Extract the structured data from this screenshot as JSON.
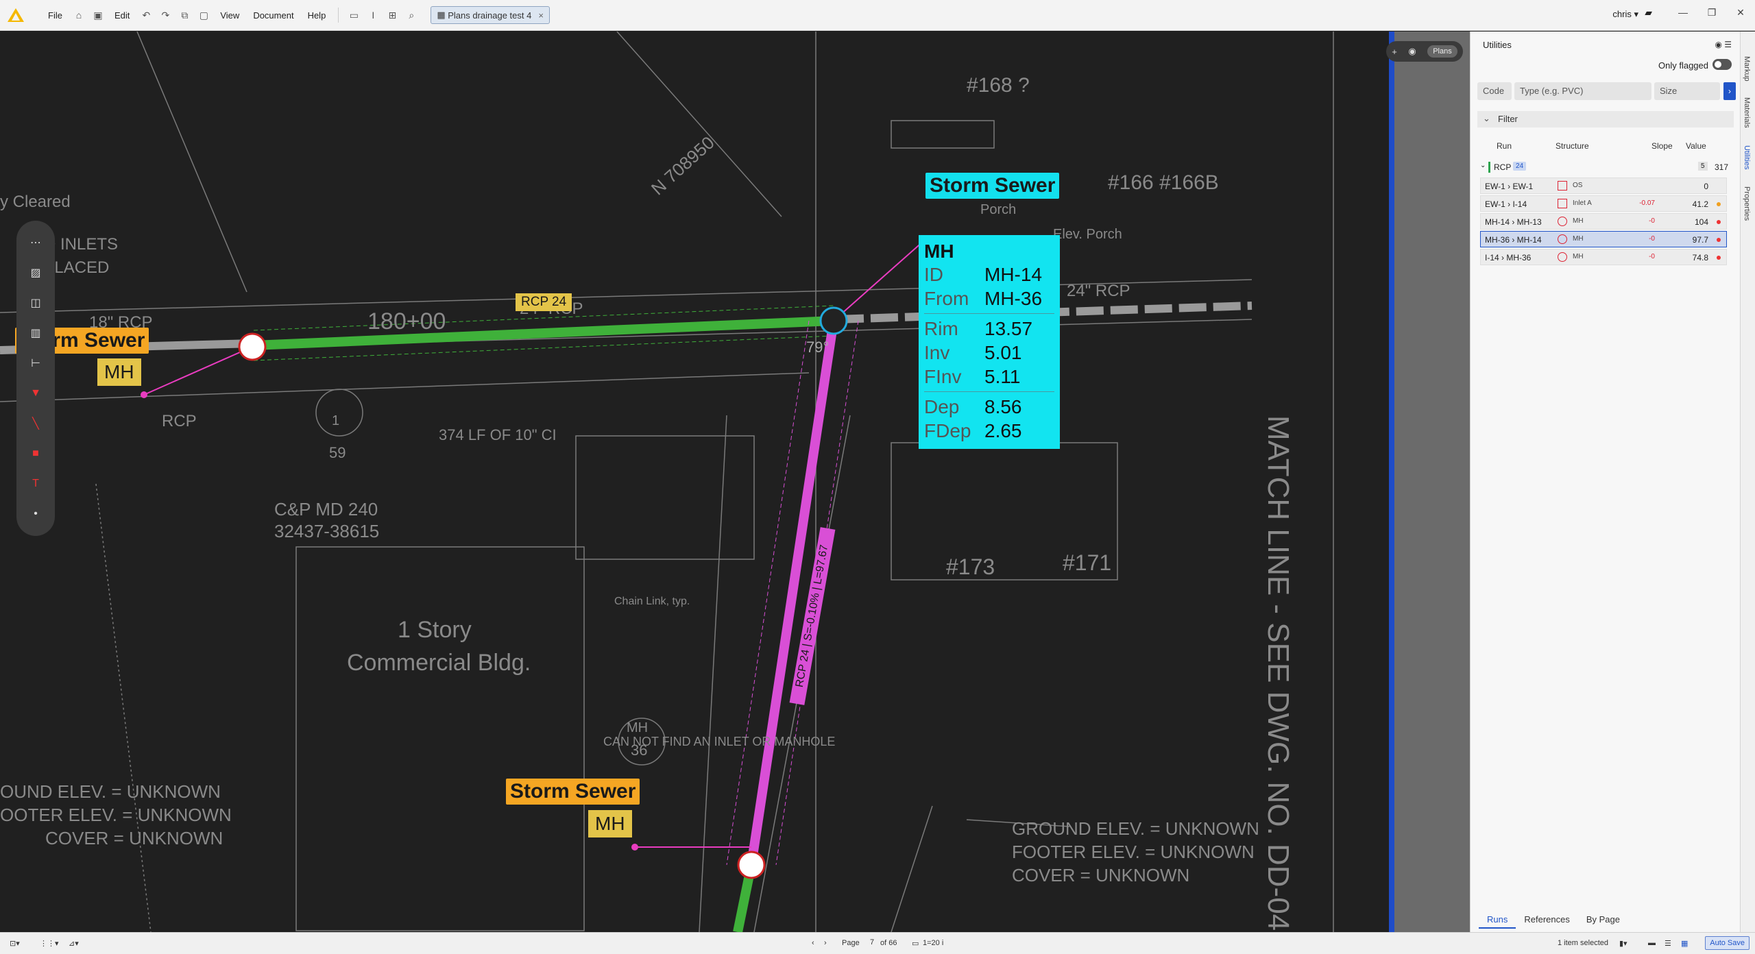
{
  "menu": {
    "file": "File",
    "edit": "Edit",
    "view": "View",
    "document": "Document",
    "help": "Help"
  },
  "document_tab": {
    "title": "Plans drainage test 4",
    "close": "×"
  },
  "user": {
    "name": "chris ▾"
  },
  "view_toggle": {
    "label": "Plans"
  },
  "map": {
    "storm_sewer_label": "Storm Sewer",
    "mh_tag": "MH",
    "selected_card": {
      "title": "Storm Sewer",
      "type": "MH",
      "rows_top": [
        {
          "k": "ID",
          "v": "MH-14"
        },
        {
          "k": "From",
          "v": "MH-36"
        }
      ],
      "rows_mid": [
        {
          "k": "Rim",
          "v": "13.57"
        },
        {
          "k": "Inv",
          "v": "5.01"
        },
        {
          "k": "FInv",
          "v": "5.11"
        }
      ],
      "rows_bot": [
        {
          "k": "Dep",
          "v": "8.56"
        },
        {
          "k": "FDep",
          "v": "2.65"
        }
      ]
    },
    "pipe_tag": "RCP 24",
    "pipe_vertical_tag": "RCP 24 | S=-0.10% | L=97.67",
    "angle": "79°"
  },
  "panel": {
    "title": "Utilities",
    "only_flagged": "Only flagged",
    "code_placeholder": "Code",
    "type_placeholder": "Type (e.g. PVC)",
    "size_placeholder": "Size",
    "filter": "Filter",
    "columns": {
      "run": "Run",
      "structure": "Structure",
      "slope": "Slope",
      "value": "Value"
    },
    "group": {
      "name": "RCP",
      "badge": "24",
      "count": "5",
      "value": "317"
    },
    "rows": [
      {
        "run": "EW-1 › EW-1",
        "structure": "OS",
        "slope": "",
        "value": "0",
        "icon": "square",
        "flag": "none"
      },
      {
        "run": "EW-1 › I-14",
        "structure": "Inlet A",
        "slope": "-0.07",
        "value": "41.2",
        "icon": "square",
        "flag": "orange"
      },
      {
        "run": "MH-14 › MH-13",
        "structure": "MH",
        "slope": "-0",
        "value": "104",
        "icon": "circle",
        "flag": "red"
      },
      {
        "run": "MH-36 › MH-14",
        "structure": "MH",
        "slope": "-0",
        "value": "97.7",
        "icon": "circle",
        "flag": "red"
      },
      {
        "run": "I-14 › MH-36",
        "structure": "MH",
        "slope": "-0",
        "value": "74.8",
        "icon": "circle",
        "flag": "red"
      }
    ],
    "bottom_tabs": [
      "Runs",
      "References",
      "By Page"
    ],
    "side_tabs": [
      "Markup",
      "Materials",
      "Utilities",
      "Properties"
    ]
  },
  "status": {
    "page_label": "Page",
    "page_current": "7",
    "page_total": "of 66",
    "scale": "1=20 i",
    "selection": "1 item selected",
    "autosave": "Auto Save"
  },
  "colors": {
    "accent": "#2155c8",
    "storm_label": "#f5a623",
    "selected_label": "#13e0ee",
    "pipe_green": "#3fb13a",
    "pipe_magenta": "#d94fd6"
  }
}
